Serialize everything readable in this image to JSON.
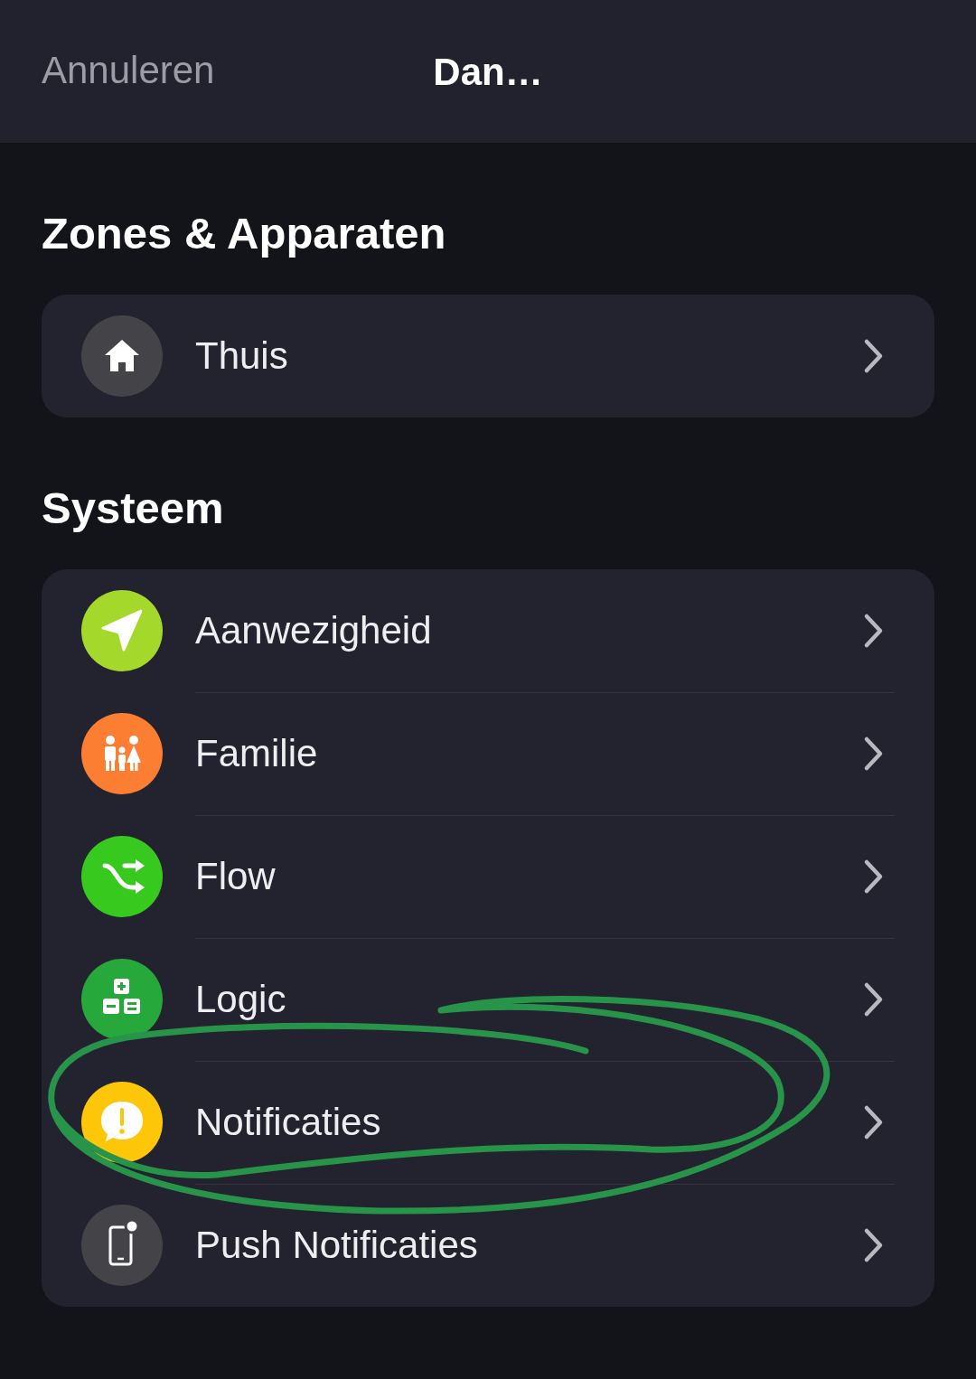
{
  "header": {
    "cancel": "Annuleren",
    "title": "Dan…"
  },
  "sections": [
    {
      "title": "Zones & Apparaten",
      "items": [
        {
          "label": "Thuis",
          "color": "#444448"
        }
      ]
    },
    {
      "title": "Systeem",
      "items": [
        {
          "label": "Aanwezigheid",
          "color": "#a4d92c"
        },
        {
          "label": "Familie",
          "color": "#fc7e33"
        },
        {
          "label": "Flow",
          "color": "#38c91e"
        },
        {
          "label": "Logic",
          "color": "#27a83a"
        },
        {
          "label": "Notificaties",
          "color": "#fdc608"
        },
        {
          "label": "Push Notificaties",
          "color": "#444448"
        }
      ]
    }
  ]
}
